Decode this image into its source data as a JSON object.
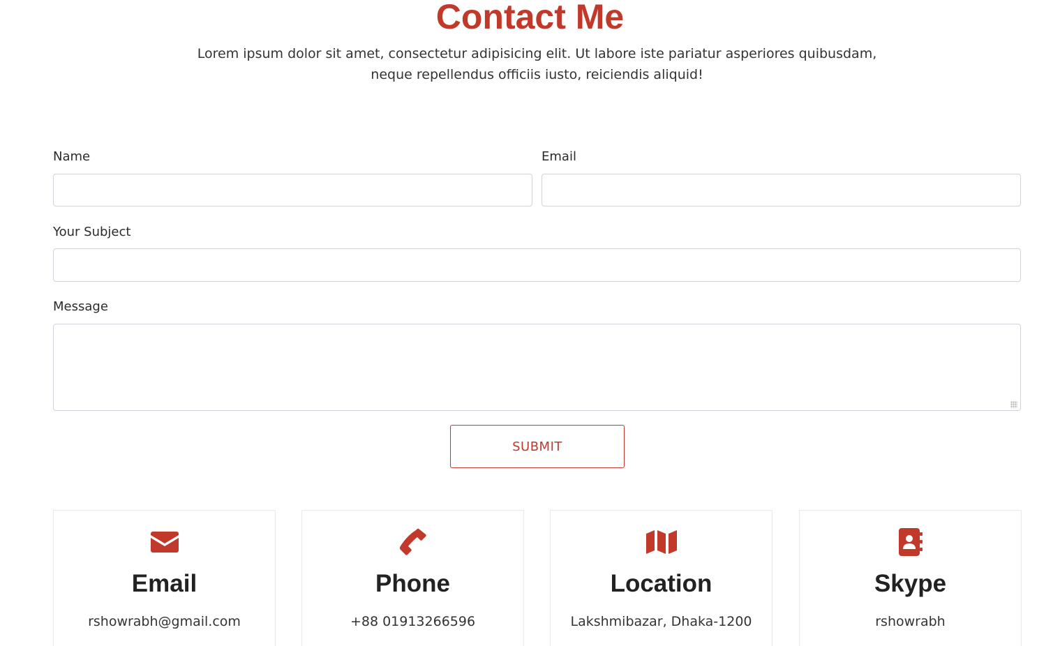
{
  "header": {
    "title": "Contact Me",
    "subtitle_line1": "Lorem ipsum dolor sit amet, consectetur adipisicing elit. Ut labore iste pariatur asperiores quibusdam,",
    "subtitle_line2": "neque repellendus officiis iusto, reiciendis aliquid!"
  },
  "form": {
    "name_label": "Name",
    "name_value": "",
    "email_label": "Email",
    "email_value": "",
    "subject_label": "Your Subject",
    "subject_value": "",
    "message_label": "Message",
    "message_value": "",
    "submit_label": "SUBMIT"
  },
  "cards": [
    {
      "icon": "envelope-icon",
      "title": "Email",
      "value": "rshowrabh@gmail.com"
    },
    {
      "icon": "phone-icon",
      "title": "Phone",
      "value": "+88 01913266596"
    },
    {
      "icon": "map-icon",
      "title": "Location",
      "value": "Lakshmibazar, Dhaka-1200"
    },
    {
      "icon": "address-book-icon",
      "title": "Skype",
      "value": "rshowrabh"
    }
  ],
  "colors": {
    "accent": "#c0392b",
    "text": "#212529",
    "border": "#ced4da"
  }
}
